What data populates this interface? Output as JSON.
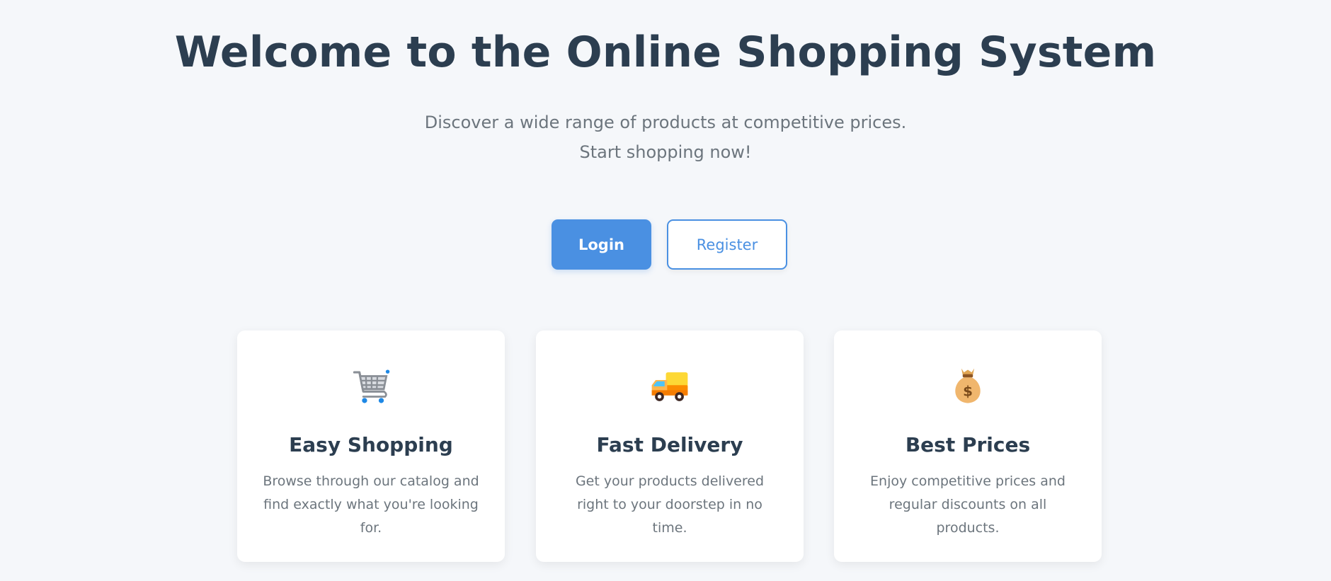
{
  "hero": {
    "title": "Welcome to the Online Shopping System",
    "subtitle": "Discover a wide range of products at competitive prices. Start shopping now!"
  },
  "actions": {
    "login_label": "Login",
    "register_label": "Register"
  },
  "features": [
    {
      "icon": "shopping-cart-icon",
      "title": "Easy Shopping",
      "description": "Browse through our catalog and find exactly what you're looking for."
    },
    {
      "icon": "delivery-truck-icon",
      "title": "Fast Delivery",
      "description": "Get your products delivered right to your doorstep in no time."
    },
    {
      "icon": "money-bag-icon",
      "title": "Best Prices",
      "description": "Enjoy competitive prices and regular discounts on all products."
    }
  ],
  "colors": {
    "primary": "#4a90e2",
    "heading": "#2c3e50",
    "text_muted": "#6c757d",
    "background": "#f5f7fa",
    "card": "#ffffff"
  }
}
